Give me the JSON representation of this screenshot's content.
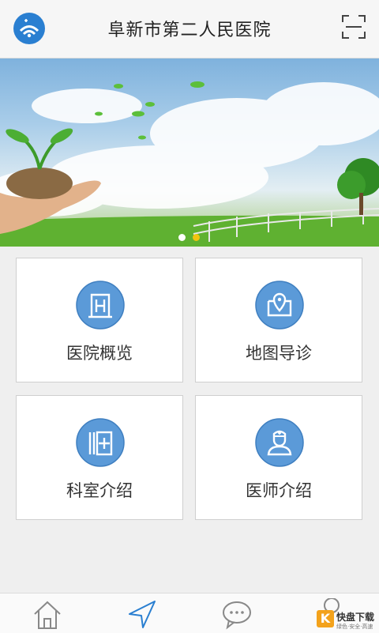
{
  "header": {
    "title": "阜新市第二人民医院",
    "logo_icon": "hospital-logo-icon",
    "scan_icon": "qr-scan-icon"
  },
  "banner": {
    "slides": 2,
    "active_index": 1,
    "description_icons": [
      "sprout-hand-image",
      "sky-clouds",
      "fence",
      "tree"
    ]
  },
  "tiles": [
    {
      "label": "医院概览",
      "icon": "hospital-building-icon"
    },
    {
      "label": "地图导诊",
      "icon": "map-location-icon"
    },
    {
      "label": "科室介绍",
      "icon": "department-icon"
    },
    {
      "label": "医师介绍",
      "icon": "doctor-icon"
    }
  ],
  "tabbar": {
    "tabs": [
      {
        "icon": "home-icon"
      },
      {
        "icon": "navigation-arrow-icon",
        "active": true
      },
      {
        "icon": "chat-bubble-icon"
      },
      {
        "icon": "profile-icon"
      }
    ]
  },
  "watermark": {
    "badge": "K",
    "name": "快盘下载",
    "slogan": "绿色·安全·高速"
  },
  "colors": {
    "accent": "#2a7fd1",
    "icon_circle": "#5b9ad8",
    "dot_active": "#f1c40f",
    "dot_inactive": "#ffffff"
  }
}
